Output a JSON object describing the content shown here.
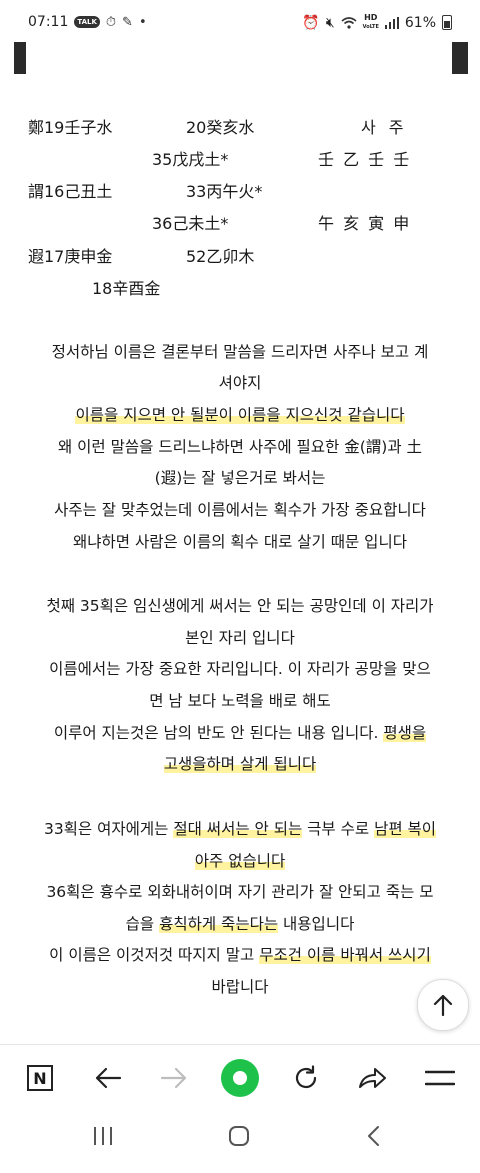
{
  "status_bar": {
    "time": "07:11",
    "talk_badge": "TALK",
    "hd_label": "HD",
    "voice_label": "VoLTE",
    "battery": "61%"
  },
  "saju_table": {
    "r1_c1": "鄭19壬子水",
    "r1_c2": "20癸亥水",
    "r1_c3": "사 주",
    "r2_c2": "35戊戌土*",
    "r2_c3": "壬 乙 壬 壬",
    "r3_c1": "謂16己丑土",
    "r3_c2": "33丙午火*",
    "r4_c2": "36己未土*",
    "r4_c3": "午 亥 寅 申",
    "r5_c1": "遐17庚申金",
    "r5_c2": "52乙卯木",
    "r6_c1": "18辛酉金"
  },
  "paragraphs": {
    "p1_l1": "정서하님 이름은 결론부터 말씀을 드리자면 사주나 보고 계",
    "p1_l2": "셔야지",
    "p1_l3": "이름을 지으면 안 될분이 이름을 지으신것 같습니다",
    "p1_l4": "왜 이런 말씀을 드리느냐하면 사주에 필요한 金(謂)과 土",
    "p1_l5": "(遐)는 잘 넣은거로 봐서는",
    "p1_l6": "사주는 잘 맞추었는데 이름에서는 획수가 가장 중요합니다",
    "p1_l7": "왜냐하면 사람은 이름의 획수 대로 살기 때문 입니다",
    "p2_l1": "첫째 35획은 임신생에게 써서는 안 되는 공망인데 이 자리가",
    "p2_l2": "본인 자리 입니다",
    "p2_l3": "이름에서는 가장 중요한 자리입니다. 이 자리가 공망을 맞으",
    "p2_l4": "면 남 보다 노력을 배로 해도",
    "p2_l5a": "이루어 지는것은 남의 반도 안 된다는 내용 입니다. ",
    "p2_l5b": "평생을",
    "p2_l6": "고생을하며 살게 됩니다",
    "p3_l1a": "33획은 여자에게는 ",
    "p3_l1b": "절대 써서는 안 되는",
    "p3_l1c": " 극부 수로 ",
    "p3_l1d": "남편 복이",
    "p3_l2": "아주 없습니다",
    "p3_l3": "36획은 흉수로 외화내허이며 자기 관리가 잘 안되고 죽는 모",
    "p3_l4a": "습을 ",
    "p3_l4b": "흉칙하게 죽는다는",
    "p3_l4c": " 내용입니다",
    "p3_l5a": "이 이름은 이것저것 따지지 말고 ",
    "p3_l5b": "무조건 이름 바꿔서 쓰시기",
    "p3_l6": "바랍니다"
  },
  "toolbar": {
    "n_label": "N"
  },
  "colors": {
    "highlight": "#fff3a0",
    "accent_green": "#1ec24a"
  }
}
